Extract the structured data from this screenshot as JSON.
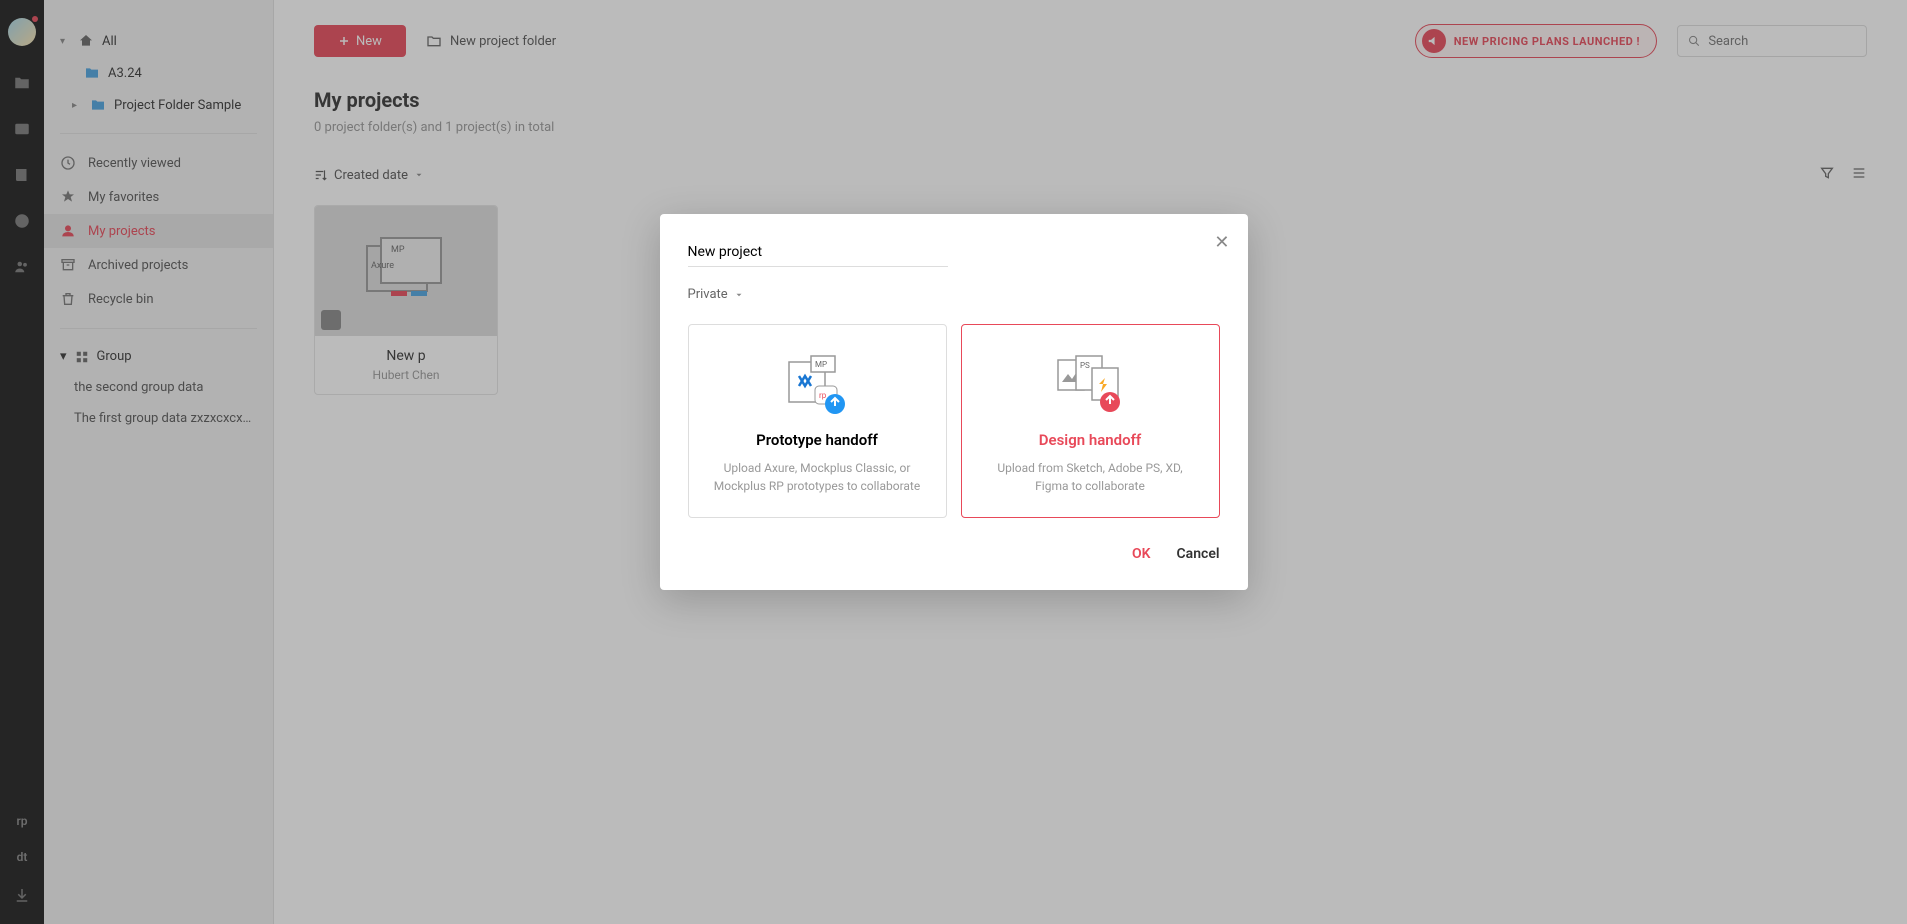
{
  "sidebar": {
    "all": "All",
    "folder1": "A3.24",
    "folder2": "Project Folder Sample",
    "recently": "Recently viewed",
    "favorites": "My favorites",
    "myprojects": "My projects",
    "archived": "Archived projects",
    "recycle": "Recycle bin",
    "group_header": "Group",
    "group1": "the second group data",
    "group2": "The first group data zxzxcxcxbv..."
  },
  "rail": {
    "rp": "rp",
    "dt": "dt"
  },
  "main": {
    "new_btn": "New",
    "new_folder": "New project folder",
    "banner": "NEW PRICING PLANS LAUNCHED !",
    "search_placeholder": "Search",
    "title": "My projects",
    "subtitle": "0 project folder(s) and 1 project(s) in total",
    "sort": "Created date",
    "card_name": "New p",
    "card_author": "Hubert Chen"
  },
  "modal": {
    "name_value": "New project",
    "privacy": "Private",
    "opt1_title": "Prototype handoff",
    "opt1_desc": "Upload Axure, Mockplus Classic, or Mockplus RP prototypes to collaborate",
    "opt2_title": "Design handoff",
    "opt2_desc": "Upload from Sketch, Adobe PS, XD, Figma to collaborate",
    "ok": "OK",
    "cancel": "Cancel"
  }
}
